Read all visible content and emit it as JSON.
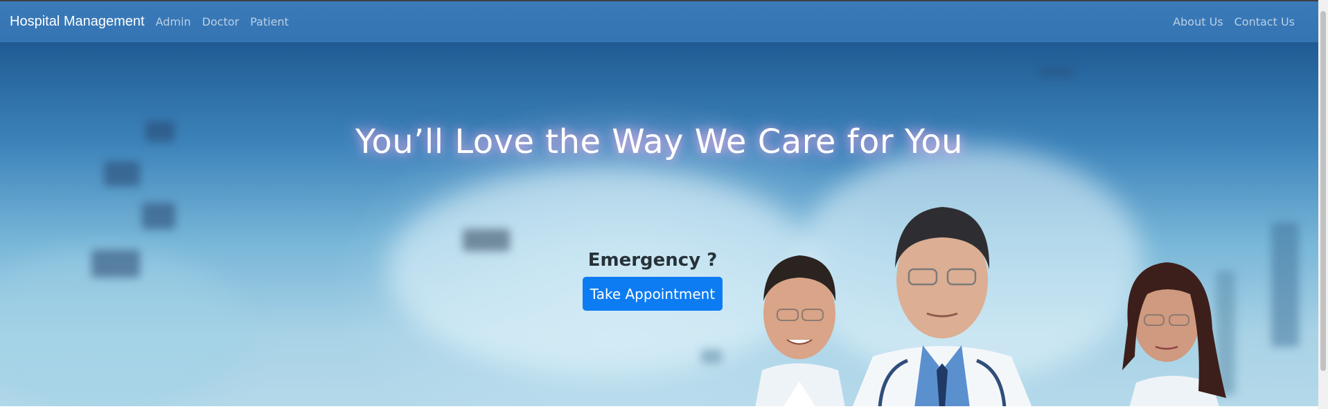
{
  "navbar": {
    "brand": "Hospital Management",
    "left_links": [
      "Admin",
      "Doctor",
      "Patient"
    ],
    "right_links": [
      "About Us",
      "Contact Us"
    ],
    "background_color": "#3676b4"
  },
  "hero": {
    "headline": "You’ll Love the Way We Care for You",
    "emergency_label": "Emergency ?",
    "appointment_button": "Take Appointment",
    "button_color": "#0d7cf2"
  }
}
